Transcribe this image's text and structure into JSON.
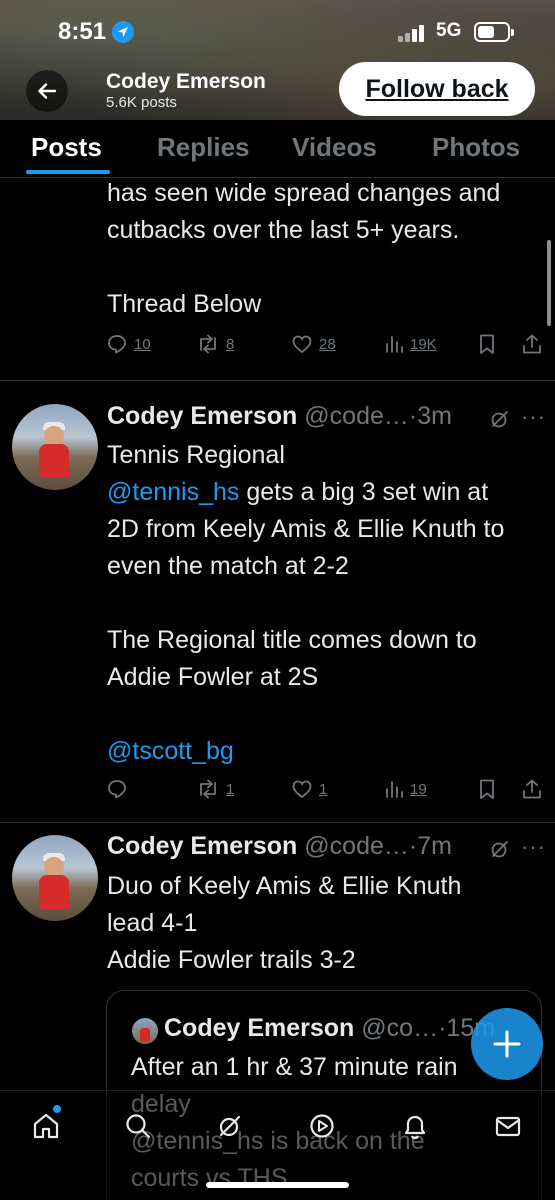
{
  "status_bar": {
    "time": "8:51",
    "network": "5G"
  },
  "profile": {
    "name": "Codey Emerson",
    "posts_count": "5.6K posts",
    "follow_label": "Follow back"
  },
  "tabs": [
    {
      "label": "Posts",
      "active": true
    },
    {
      "label": "Replies",
      "active": false
    },
    {
      "label": "Videos",
      "active": false
    },
    {
      "label": "Photos",
      "active": false
    }
  ],
  "tweet_partial": {
    "text": "has seen wide spread changes and\ncutbacks over the last 5+ years.\n\nThread Below",
    "replies": "10",
    "reposts": "8",
    "likes": "28",
    "views": "19K"
  },
  "tweet_1": {
    "name": "Codey Emerson",
    "handle": "@code…",
    "time": "·3m",
    "line1": "Tennis Regional",
    "mention": "@tennis_hs",
    "line2_rest": " gets a big 3 set win at",
    "line3": "2D from Keely Amis & Ellie Knuth to",
    "line4": "even the match at 2-2",
    "line5": "The Regional title comes down to",
    "line6": "Addie Fowler at 2S",
    "tag": "@tscott_bg",
    "replies": "",
    "reposts": "1",
    "likes": "1",
    "views": "19"
  },
  "tweet_2": {
    "name": "Codey Emerson",
    "handle": "@code…",
    "time": "·7m",
    "text": "Duo of Keely Amis & Ellie Knuth\nlead 4-1\nAddie Fowler trails 3-2"
  },
  "quote": {
    "name": "Codey Emerson",
    "handle": "@co…",
    "time": "·15m",
    "text": "After an 1 hr & 37 minute rain\ndelay\n@tennis_hs is back on the\ncourts vs THS"
  },
  "colors": {
    "accent": "#1d9bf0",
    "background": "#000000",
    "muted": "#71767b"
  },
  "icons": [
    "back-arrow-icon",
    "location-arrow-icon",
    "reply-icon",
    "repost-icon",
    "like-icon",
    "views-icon",
    "bookmark-icon",
    "share-icon",
    "grok-icon",
    "more-icon",
    "compose-icon",
    "home-icon",
    "search-icon",
    "grok-nav-icon",
    "communities-icon",
    "notifications-icon",
    "messages-icon"
  ]
}
